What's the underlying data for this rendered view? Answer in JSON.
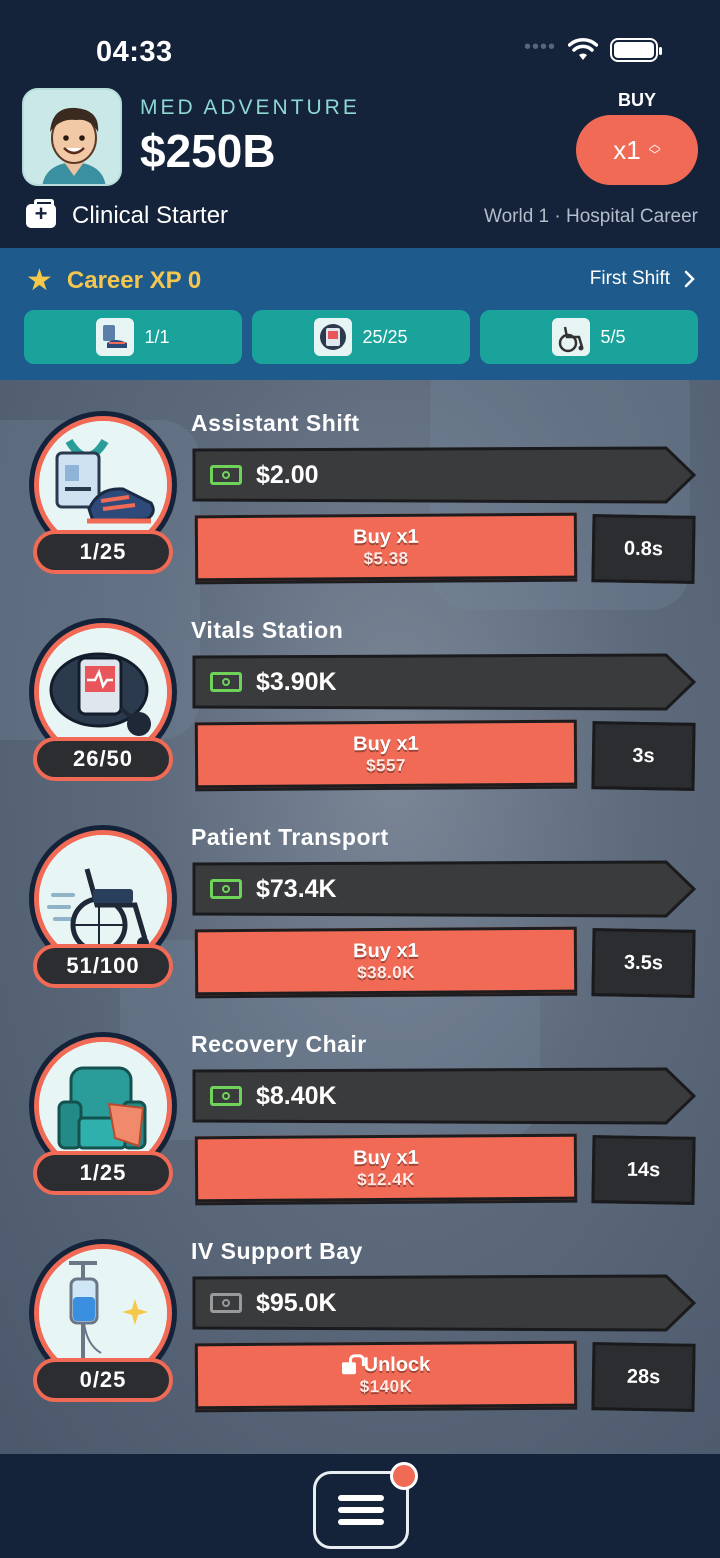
{
  "status_bar": {
    "time": "04:33",
    "signal_dots": "••••"
  },
  "header": {
    "game_title": "MED ADVENTURE",
    "balance": "$250B",
    "buy_label": "BUY",
    "buy_multiplier": "x1",
    "career_title": "Clinical Starter",
    "world_label": "World 1 · Hospital Career"
  },
  "xp_panel": {
    "xp_text": "Career XP 0",
    "first_shift": "First Shift",
    "chips": [
      {
        "label": "1/1",
        "icon": "shoes-icon"
      },
      {
        "label": "25/25",
        "icon": "monitor-icon"
      },
      {
        "label": "5/5",
        "icon": "wheelchair-icon"
      }
    ]
  },
  "businesses": [
    {
      "name": "Assistant Shift",
      "count": "1/25",
      "revenue": "$2.00",
      "buy_label": "Buy x1",
      "cost": "$5.38",
      "timer": "0.8s",
      "icon": "badge-shoes-icon",
      "locked": false
    },
    {
      "name": "Vitals Station",
      "count": "26/50",
      "revenue": "$3.90K",
      "buy_label": "Buy x1",
      "cost": "$557",
      "timer": "3s",
      "icon": "blood-pressure-icon",
      "locked": false
    },
    {
      "name": "Patient Transport",
      "count": "51/100",
      "revenue": "$73.4K",
      "buy_label": "Buy x1",
      "cost": "$38.0K",
      "timer": "3.5s",
      "icon": "wheelchair-icon",
      "locked": false
    },
    {
      "name": "Recovery Chair",
      "count": "1/25",
      "revenue": "$8.40K",
      "buy_label": "Buy x1",
      "cost": "$12.4K",
      "timer": "14s",
      "icon": "recliner-icon",
      "locked": false
    },
    {
      "name": "IV Support Bay",
      "count": "0/25",
      "revenue": "$95.0K",
      "buy_label": "Unlock",
      "cost": "$140K",
      "timer": "28s",
      "icon": "iv-drip-icon",
      "locked": true
    }
  ],
  "colors": {
    "accent": "#f06a55",
    "navy": "#14223a",
    "teal": "#1aa39a",
    "cash_green": "#6fd35a",
    "cash_grey": "#9a9a9a"
  }
}
